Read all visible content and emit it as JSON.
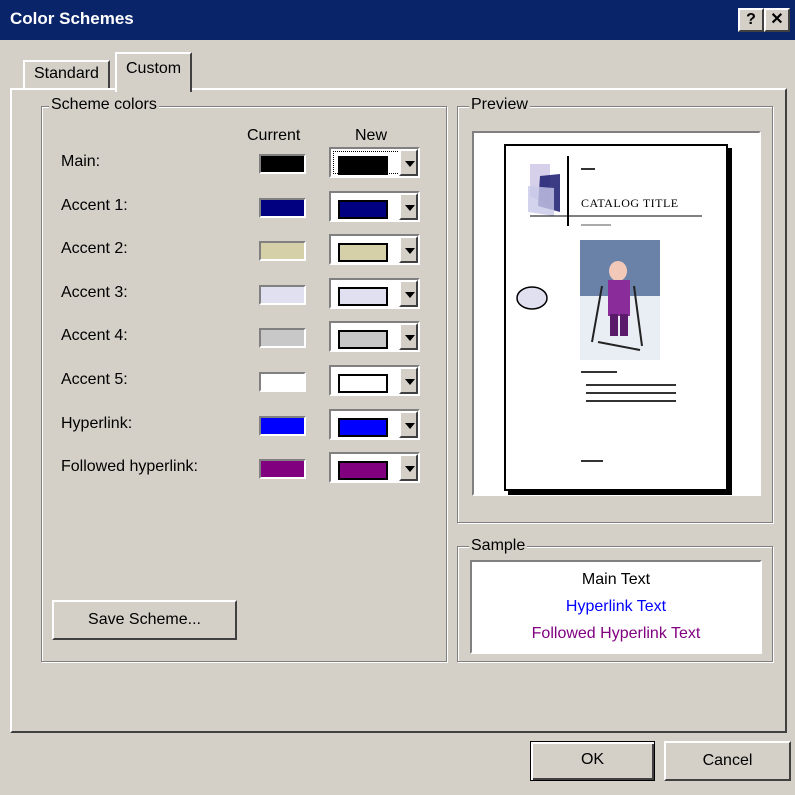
{
  "window": {
    "title": "Color Schemes",
    "help_glyph": "?",
    "close_glyph": "✕"
  },
  "tabs": [
    {
      "label": "Standard"
    },
    {
      "label": "Custom"
    }
  ],
  "scheme": {
    "legend": "Scheme colors",
    "col_current": "Current",
    "col_new": "New",
    "rows": [
      {
        "label": "Main:",
        "color": "#000000"
      },
      {
        "label": "Accent 1:",
        "color": "#000080"
      },
      {
        "label": "Accent 2:",
        "color": "#d6d0a8"
      },
      {
        "label": "Accent 3:",
        "color": "#e0e0f0"
      },
      {
        "label": "Accent 4:",
        "color": "#c8c8c8"
      },
      {
        "label": "Accent 5:",
        "color": "#ffffff"
      },
      {
        "label": "Hyperlink:",
        "color": "#0000ff"
      },
      {
        "label": "Followed hyperlink:",
        "color": "#800080"
      }
    ],
    "save_label": "Save Scheme..."
  },
  "preview": {
    "legend": "Preview",
    "catalog_title": "CATALOG TITLE"
  },
  "sample": {
    "legend": "Sample",
    "main_text": "Main Text",
    "hyperlink_text": "Hyperlink Text",
    "followed_text": "Followed Hyperlink Text",
    "main_color": "#000000",
    "hyperlink_color": "#0000ff",
    "followed_color": "#800080"
  },
  "buttons": {
    "ok": "OK",
    "cancel": "Cancel"
  }
}
